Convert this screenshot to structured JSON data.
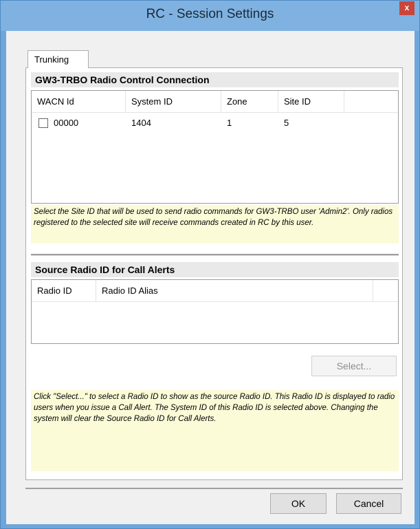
{
  "window": {
    "title": "RC - Session Settings",
    "close_label": "x"
  },
  "tabs": [
    {
      "label": "Trunking"
    }
  ],
  "connection": {
    "header": "GW3-TRBO Radio Control Connection",
    "columns": [
      "WACN Id",
      "System ID",
      "Zone",
      "Site ID"
    ],
    "rows": [
      {
        "checked": false,
        "wacn": "00000",
        "system_id": "1404",
        "zone": "1",
        "site_id": "5"
      }
    ],
    "info": "Select the Site ID that will be used to send radio commands for GW3-TRBO user 'Admin2'. Only radios registered to the selected site will receive commands created in RC by this user."
  },
  "source_radio": {
    "header": "Source Radio ID for Call Alerts",
    "columns": [
      "Radio ID",
      "Radio ID Alias"
    ],
    "select_label": "Select...",
    "info": "Click \"Select...\" to select a Radio ID to show as the source Radio ID. This Radio ID is displayed to radio users when you issue a Call Alert. The System ID of this Radio ID is selected above. Changing the system will clear the Source Radio ID for Call Alerts."
  },
  "footer": {
    "ok_label": "OK",
    "cancel_label": "Cancel"
  }
}
